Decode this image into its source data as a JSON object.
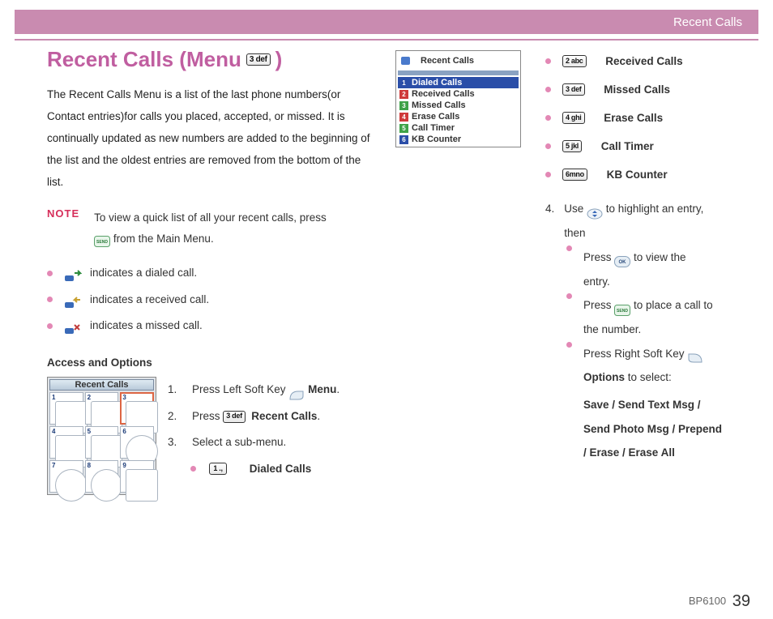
{
  "header": {
    "sectionLabel": "Recent Calls"
  },
  "title": {
    "prefix": "Recent Calls (Menu ",
    "key": "3 def",
    "suffix": ")"
  },
  "intro": "The Recent Calls Menu is a list of the last phone numbers(or Contact entries)for calls you placed, accepted, or missed. It is continually updated as new numbers are added to the begin­ning of the list and the oldest entries are removed from the bot­tom of the list.",
  "note": {
    "label": "NOTE",
    "line1": "To view a quick list of all your recent calls, press",
    "line2": "from the Main Menu."
  },
  "indicators": [
    {
      "text": "indicates a dialed call."
    },
    {
      "text": "indicates a received call."
    },
    {
      "text": "indicates a missed call."
    }
  ],
  "accessHeading": "Access and Options",
  "menuGrid": {
    "title": "Recent Calls",
    "cells": [
      "1",
      "2",
      "3",
      "4",
      "5",
      "6",
      "7",
      "8",
      "9"
    ]
  },
  "steps": {
    "s1_pre": "Press Left Soft Key ",
    "s1_bold": "Menu",
    "s2_pre": "Press ",
    "s2_key": "3 def",
    "s2_bold": "Recent Calls",
    "s3": "Select a sub-menu.",
    "s3_sub_key": "1 .,",
    "s3_sub_bold": "Dialed Calls"
  },
  "listScreen": {
    "title": "Recent Calls",
    "items": [
      "Dialed Calls",
      "Received Calls",
      "Missed Calls",
      "Erase Calls",
      "Call Timer",
      "KB Counter"
    ]
  },
  "rightMenu": [
    {
      "key": "2 abc",
      "label": "Received Calls"
    },
    {
      "key": "3 def",
      "label": "Missed Calls"
    },
    {
      "key": "4 ghi",
      "label": "Erase Calls"
    },
    {
      "key": "5 jkl",
      "label": "Call Timer"
    },
    {
      "key": "6mno",
      "label": "KB Counter"
    }
  ],
  "step4": {
    "num": "4.",
    "line_a": "Use ",
    "line_b": " to highlight an entry,",
    "then": "then",
    "sub1_a": "Press ",
    "sub1_b": " to view the",
    "sub1_c": "entry.",
    "sub2_a": "Press ",
    "sub2_b": " to place a call to",
    "sub2_c": "the number.",
    "sub3_a": "Press Right Soft Key ",
    "sub3_b": "Options",
    "sub3_c": " to select:",
    "options": "Save / Send Text Msg / Send Photo Msg / Prepend / Erase / Erase All"
  },
  "footer": {
    "model": "BP6100",
    "page": "39"
  }
}
